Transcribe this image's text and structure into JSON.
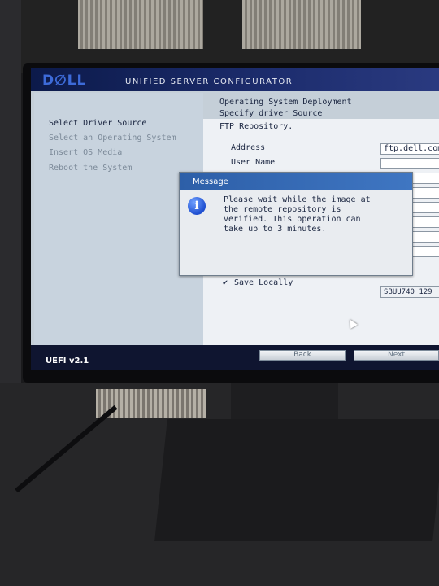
{
  "header": {
    "brand": "D∅LL",
    "title": "UNIFIED SERVER CONFIGURATOR"
  },
  "nav": {
    "items": [
      {
        "label": "Select Driver Source",
        "active": true
      },
      {
        "label": "Select an Operating System",
        "active": false
      },
      {
        "label": "Insert OS Media",
        "active": false
      },
      {
        "label": "Reboot the System",
        "active": false
      }
    ]
  },
  "breadcrumb": {
    "section": "Operating System Deployment",
    "page": "Specify driver Source"
  },
  "form": {
    "source_label": "FTP Repository.",
    "address_label": "Address",
    "address_value": "ftp.dell.com",
    "username_label": "User Name",
    "username_value": "",
    "save_locally_label": "Save Locally",
    "save_locally_checked": true,
    "share_value": "SBUU740_129"
  },
  "dialog": {
    "title": "Message",
    "message": "Please wait while the image at the remote repository is verified. This operation can take up to 3 minutes."
  },
  "footer": {
    "version": "UEFI v2.1",
    "back_label": "Back",
    "next_label": "Next"
  },
  "colors": {
    "title_bar": "#1d2d6e",
    "dialog_header": "#3f76c2",
    "footer_bar": "#0f1530"
  }
}
